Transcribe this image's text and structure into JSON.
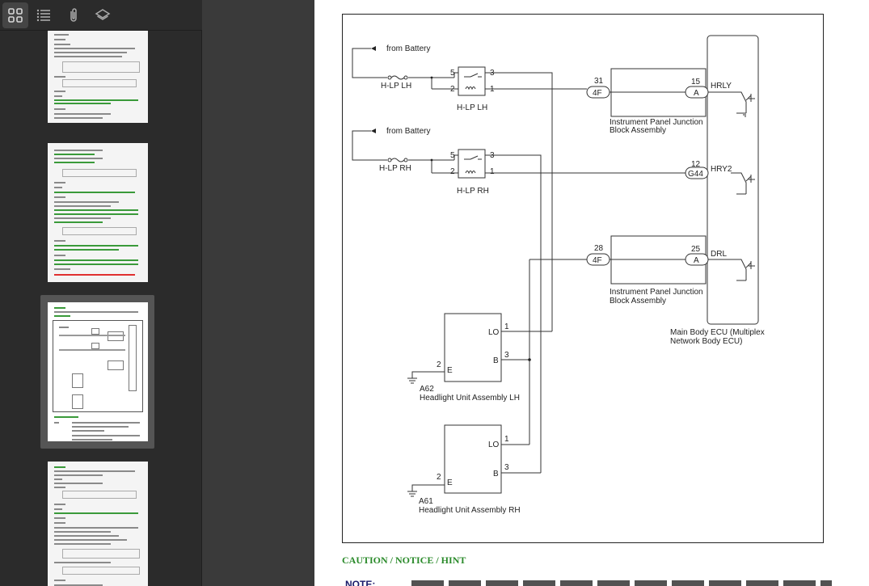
{
  "toolbar": {
    "thumbnails_icon": "grid-icon",
    "outline_icon": "list-icon",
    "attachments_icon": "paperclip-icon",
    "layers_icon": "layers-icon"
  },
  "diagram": {
    "battery_top": "from Battery",
    "battery_bottom": "from Battery",
    "hlp_lh_fuse": "H-LP LH",
    "hlp_rh_fuse": "H-LP RH",
    "relay_lh": "H-LP LH",
    "relay_rh": "H-LP RH",
    "relay_lh_pin5": "5",
    "relay_lh_pin3": "3",
    "relay_lh_pin2": "2",
    "relay_lh_pin1": "1",
    "relay_rh_pin5": "5",
    "relay_rh_pin3": "3",
    "relay_rh_pin2": "2",
    "relay_rh_pin1": "1",
    "conn_31": "31",
    "conn_4f_a": "4F",
    "conn_15": "15",
    "conn_a_1": "A",
    "hrly": "HRLY",
    "ipjb_1_line1": "Instrument Panel Junction",
    "ipjb_1_line2": "Block Assembly",
    "conn_12": "12",
    "conn_g44": "G44",
    "hry2": "HRY2",
    "conn_28": "28",
    "conn_4f_b": "4F",
    "conn_25": "25",
    "conn_a_2": "A",
    "drl": "DRL",
    "ipjb_2_line1": "Instrument Panel Junction",
    "ipjb_2_line2": "Block Assembly",
    "ecu_line1": "Main Body ECU (Multiplex",
    "ecu_line2": "Network Body ECU)",
    "lh_lo": "LO",
    "lh_pin1": "1",
    "lh_b": "B",
    "lh_pin3": "3",
    "lh_e": "E",
    "lh_pin2": "2",
    "lh_code": "A62",
    "lh_name": "Headlight Unit Assembly LH",
    "rh_lo": "LO",
    "rh_pin1": "1",
    "rh_b": "B",
    "rh_pin3": "3",
    "rh_e": "E",
    "rh_pin2": "2",
    "rh_code": "A61",
    "rh_name": "Headlight Unit Assembly RH"
  },
  "caution_heading": "CAUTION / NOTICE / HINT",
  "note_label": "NOTE:",
  "colors": {
    "heading_green": "#2a8a2a",
    "sidebar": "#2b2b2b",
    "page": "#ffffff"
  }
}
